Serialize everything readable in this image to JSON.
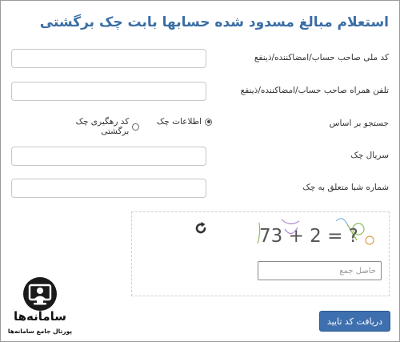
{
  "page": {
    "title": "استعلام مبالغ مسدود شده حسابها بابت چک برگشتی"
  },
  "form": {
    "national_id_label": "کد ملی صاحب حساب/امضاکننده/ذینفع",
    "national_id_value": "",
    "phone_label": "تلفن همراه صاحب حساب/امضاکننده/ذینفع",
    "phone_value": "",
    "search_label": "جستجو بر اساس",
    "radio_check_info": "اطلاعات چک",
    "radio_tracking_code": "کد رهگیری چک برگشتی",
    "serial_label": "سریال چک",
    "serial_value": "",
    "sheba_label": "شماره شبا متعلق به چک",
    "sheba_value": ""
  },
  "captcha": {
    "text": "73 + 2 = ?",
    "input_placeholder": "حاصل جمع"
  },
  "actions": {
    "submit_label": "دریافت کد تایید"
  },
  "branding": {
    "logo_name": "سامانه‌ها",
    "logo_tagline": "پورتال جامع سامانه‌ها"
  },
  "colors": {
    "title": "#3a6ea5",
    "button": "#3e6fae"
  }
}
